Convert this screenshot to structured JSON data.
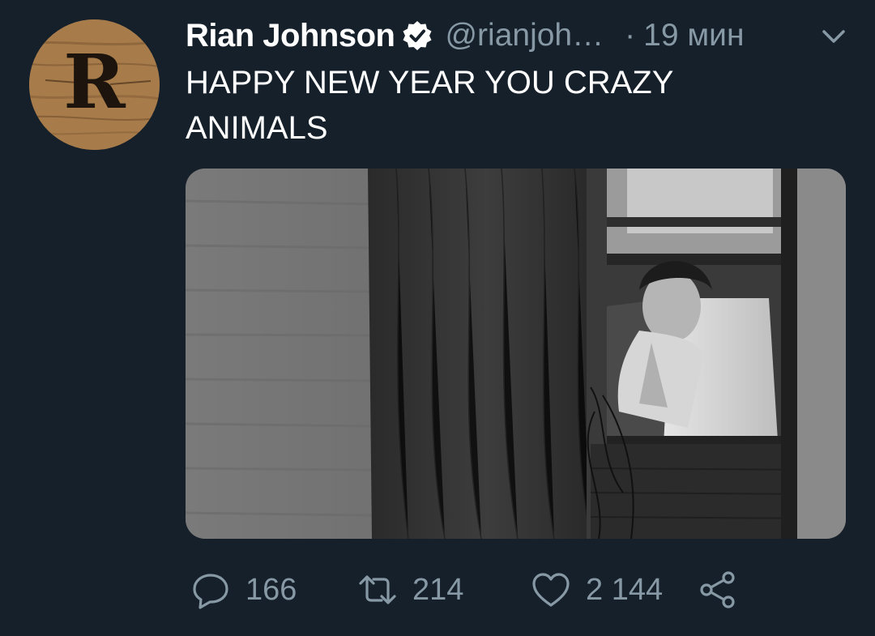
{
  "tweet": {
    "display_name": "Rian Johnson",
    "handle": "@rianjoh…",
    "separator": "·",
    "time": "19 мин",
    "text": "HAPPY NEW YEAR YOU CRAZY ANIMALS",
    "avatar_letter": "R",
    "verified": true
  },
  "actions": {
    "replies": "166",
    "retweets": "214",
    "likes": "2 144"
  },
  "colors": {
    "background": "#15202b",
    "secondary_text": "#8899a6",
    "primary_text": "#ffffff"
  },
  "icons": {
    "verified": "verified-badge-icon",
    "menu": "chevron-down-icon",
    "reply": "reply-icon",
    "retweet": "retweet-icon",
    "like": "heart-icon",
    "share": "share-icon"
  }
}
